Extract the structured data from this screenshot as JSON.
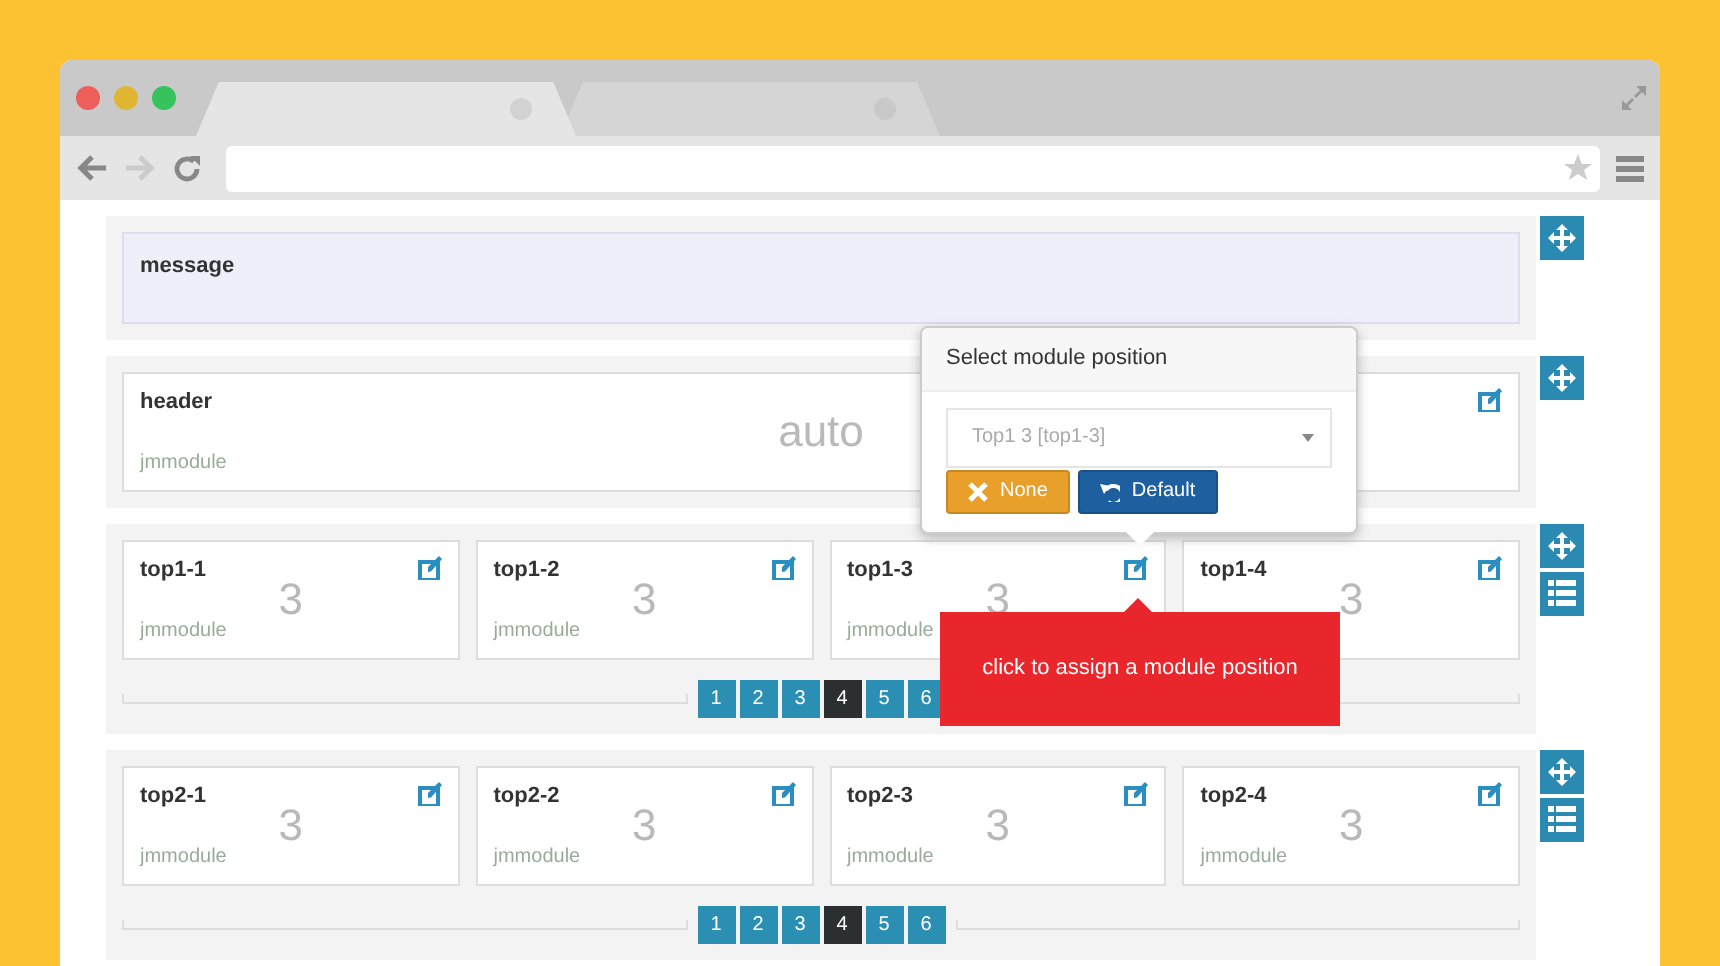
{
  "browser": {
    "tabs": [
      {
        "selected": true
      },
      {
        "selected": false
      }
    ]
  },
  "rows": [
    {
      "kind": "message",
      "title": "message",
      "handles": [
        {
          "kind": "move"
        }
      ]
    },
    {
      "kind": "single",
      "modules": [
        {
          "title": "header",
          "size": "auto",
          "module": "jmmodule"
        }
      ],
      "handles": [
        {
          "kind": "move"
        }
      ]
    },
    {
      "kind": "grid",
      "modules": [
        {
          "title": "top1-1",
          "size": "3",
          "module": "jmmodule"
        },
        {
          "title": "top1-2",
          "size": "3",
          "module": "jmmodule"
        },
        {
          "title": "top1-3",
          "size": "3",
          "module": "jmmodule"
        },
        {
          "title": "top1-4",
          "size": "3"
        }
      ],
      "pages": [
        {
          "label": "1",
          "selected": false
        },
        {
          "label": "2",
          "selected": false
        },
        {
          "label": "3",
          "selected": false
        },
        {
          "label": "4",
          "selected": true
        },
        {
          "label": "5",
          "selected": false
        },
        {
          "label": "6",
          "selected": false
        }
      ],
      "handles": [
        {
          "kind": "move"
        },
        {
          "kind": "layout"
        }
      ]
    },
    {
      "kind": "grid",
      "modules": [
        {
          "title": "top2-1",
          "size": "3",
          "module": "jmmodule"
        },
        {
          "title": "top2-2",
          "size": "3",
          "module": "jmmodule"
        },
        {
          "title": "top2-3",
          "size": "3",
          "module": "jmmodule"
        },
        {
          "title": "top2-4",
          "size": "3",
          "module": "jmmodule"
        }
      ],
      "pages": [
        {
          "label": "1",
          "selected": false
        },
        {
          "label": "2",
          "selected": false
        },
        {
          "label": "3",
          "selected": false
        },
        {
          "label": "4",
          "selected": true
        },
        {
          "label": "5",
          "selected": false
        },
        {
          "label": "6",
          "selected": false
        }
      ],
      "handles": [
        {
          "kind": "move"
        },
        {
          "kind": "layout"
        }
      ]
    }
  ],
  "popover": {
    "title": "Select module position",
    "select_value": "Top1 3 [top1-3]",
    "buttons": [
      {
        "kind": "none",
        "label": "None"
      },
      {
        "kind": "default",
        "label": "Default"
      }
    ]
  },
  "tooltip": {
    "text": "click to assign a module position"
  }
}
